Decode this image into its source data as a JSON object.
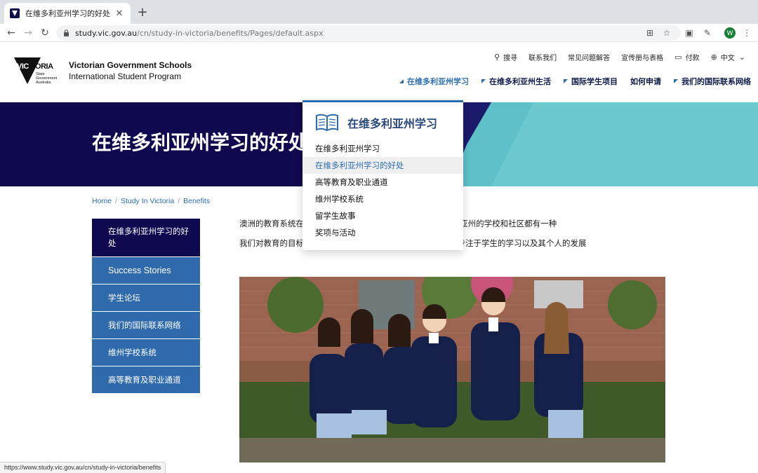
{
  "browser": {
    "tab_title": "在维多利亚州学习的好处",
    "new_tab_label": "+",
    "url_host": "study.vic.gov.au",
    "url_path": "/cn/study-in-victoria/benefits/Pages/default.aspx",
    "profile_initial": "W",
    "status_url": "https://www.study.vic.gov.au/cn/study-in-victoria/benefits"
  },
  "header": {
    "logo_line1": "Victorian Government Schools",
    "logo_line2": "International Student Program",
    "util_nav": [
      {
        "label": "搜寻",
        "icon": "search-icon"
      },
      {
        "label": "联系我们"
      },
      {
        "label": "常见问题解答"
      },
      {
        "label": "宣传册与表格"
      },
      {
        "label": "付款",
        "icon": "card-icon"
      },
      {
        "label": "中文",
        "icon": "globe-icon"
      }
    ],
    "main_nav": [
      {
        "label": "在维多利亚州学习",
        "active": true
      },
      {
        "label": "在维多利亚州生活"
      },
      {
        "label": "国际学生项目"
      },
      {
        "label": "如何申请"
      },
      {
        "label": "我们的国际联系网络"
      }
    ]
  },
  "hero": {
    "title": "在维多利亚州学习的好处"
  },
  "dropdown": {
    "title": "在维多利亚州学习",
    "items": [
      "在维多利亚州学习",
      "在维多利亚州学习的好处",
      "高等教育及职业通道",
      "维州学校系统",
      "留学生故事",
      "奖项与活动"
    ],
    "hover_index": 1
  },
  "breadcrumb": [
    "Home",
    "Study In Victoria",
    "Benefits"
  ],
  "sidebar": [
    "在维多利亚州学习的好处",
    "Success Stories",
    "学生论坛",
    "我们的国际联系网络",
    "维州学校系统",
    "高等教育及职业通道"
  ],
  "content": {
    "p1": "澳洲的教育系统在 我们坚持我们的国际视野。澳大利亚维多利亚州的学校和社区都有一种",
    "p2": "我们对教育的目标不在于每所学校，而在于每一个学生。我们专注于学生的学习以及其个人的发展"
  },
  "colors": {
    "navy": "#0f0a4f",
    "blue": "#2f6aad",
    "teal": "#5ec1c9",
    "accent": "#2b6cb0"
  }
}
